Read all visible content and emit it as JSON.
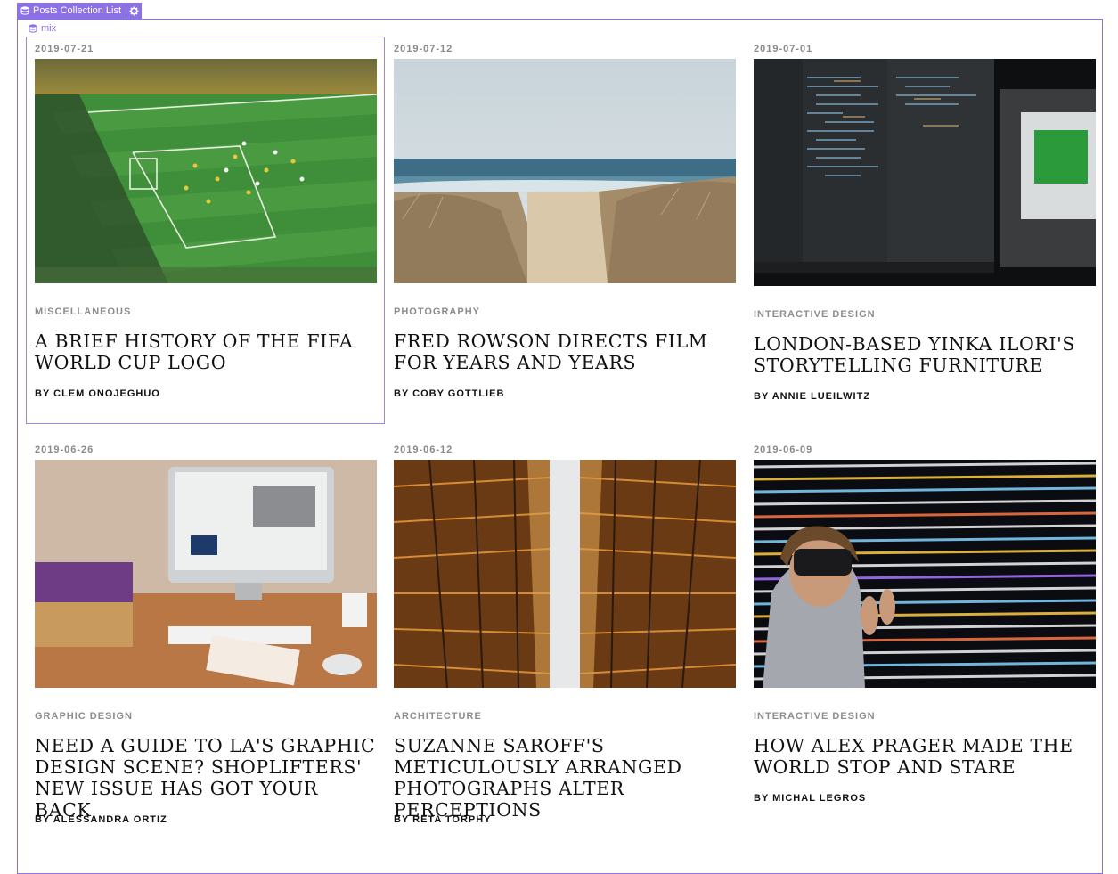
{
  "collection": {
    "tag_label": "Posts Collection List",
    "mix_label": "mix"
  },
  "posts": [
    {
      "date": "2019-07-21",
      "category": "MISCELLANEOUS",
      "title": "A BRIEF HISTORY OF THE FIFA WORLD CUP LOGO",
      "author": "BY  CLEM ONOJEGHUO",
      "image": "soccer-stadium-image"
    },
    {
      "date": "2019-07-12",
      "category": "PHOTOGRAPHY",
      "title": "FRED ROWSON DIRECTS FILM FOR YEARS AND YEARS",
      "author": "BY  COBY GOTTLIEB",
      "image": "beach-dunes-image"
    },
    {
      "date": "2019-07-01",
      "category": "INTERACTIVE DESIGN",
      "title": "LONDON-BASED YINKA ILORI'S STORYTELLING FURNITURE",
      "author": "BY  ANNIE LUEILWITZ",
      "image": "code-monitors-image"
    },
    {
      "date": "2019-06-26",
      "category": "GRAPHIC DESIGN",
      "title": "NEED A GUIDE TO LA'S GRAPHIC DESIGN SCENE? SHOPLIFTERS' NEW ISSUE HAS GOT YOUR BACK",
      "author": "BY  ALESSANDRA ORTIZ",
      "image": "designer-desk-image"
    },
    {
      "date": "2019-06-12",
      "category": "ARCHITECTURE",
      "title": "SUZANNE SAROFF'S METICULOUSLY ARRANGED PHOTOGRAPHS ALTER PERCEPTIONS",
      "author": "BY  RETA TORPHY",
      "image": "skyscrapers-image"
    },
    {
      "date": "2019-06-09",
      "category": "INTERACTIVE DESIGN",
      "title": "HOW ALEX PRAGER MADE THE WORLD STOP AND STARE",
      "author": "BY  MICHAL LEGROS",
      "image": "vr-headset-code-image"
    }
  ]
}
